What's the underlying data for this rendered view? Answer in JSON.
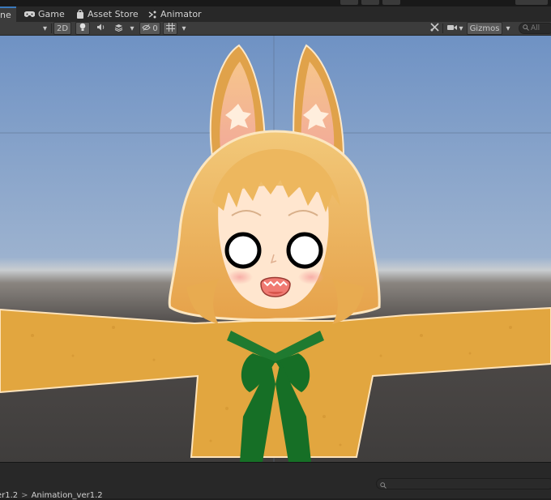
{
  "tabs": [
    {
      "label": "ne",
      "icon": "scene-icon",
      "active": true
    },
    {
      "label": "Game",
      "icon": "gamepad-icon",
      "active": false
    },
    {
      "label": "Asset Store",
      "icon": "shopping-bag-icon",
      "active": false
    },
    {
      "label": "Animator",
      "icon": "animator-icon",
      "active": false
    }
  ],
  "toolbar": {
    "mode_2d": "2D",
    "hidden_count": "0",
    "gizmos_label": "Gizmos",
    "search_placeholder": "All"
  },
  "breadcrumb": [
    "er1.2",
    "Animation_ver1.2"
  ],
  "colors": {
    "sky_top": "#6f92c4",
    "skin": "#ffe6cf",
    "hair": "#ecb55c",
    "fur": "#e2a63f",
    "ribbon": "#166f26",
    "tab_accent": "#3a79bb"
  }
}
